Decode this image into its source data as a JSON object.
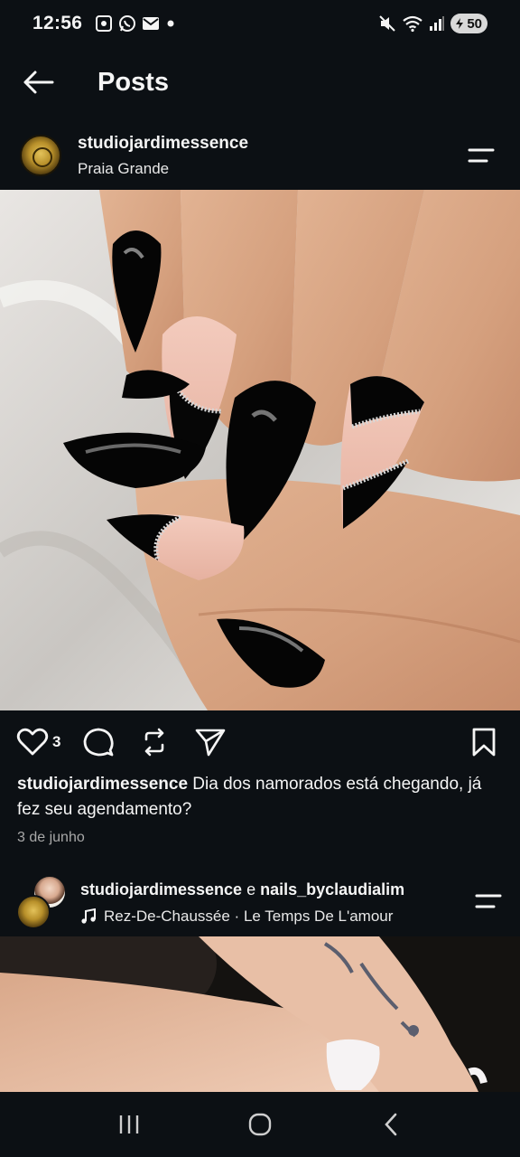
{
  "status_bar": {
    "time": "12:56",
    "battery": "50",
    "left_icons": [
      "screenshot-icon",
      "whatsapp-icon",
      "mail-icon",
      "dot-icon"
    ],
    "right_icons": [
      "mute-icon",
      "wifi-icon",
      "signal-icon",
      "battery-icon"
    ]
  },
  "header": {
    "title": "Posts",
    "back_icon": "arrow-left-icon"
  },
  "post": {
    "username": "studiojardimessence",
    "location": "Praia Grande",
    "like_count": "3",
    "caption_user": "studiojardimessence",
    "caption_text": " Dia dos namorados está chegando, já fez seu agendamento?",
    "date": "3 de junho"
  },
  "next_post": {
    "user1": "studiojardimessence",
    "joiner": " e ",
    "user2": "nails_byclaudialim",
    "music": "Rez-De-Chaussée · Le Temps De L'amour"
  },
  "colors": {
    "background": "#0c1014",
    "text": "#f5f5f5",
    "muted": "#a8a8a8"
  }
}
